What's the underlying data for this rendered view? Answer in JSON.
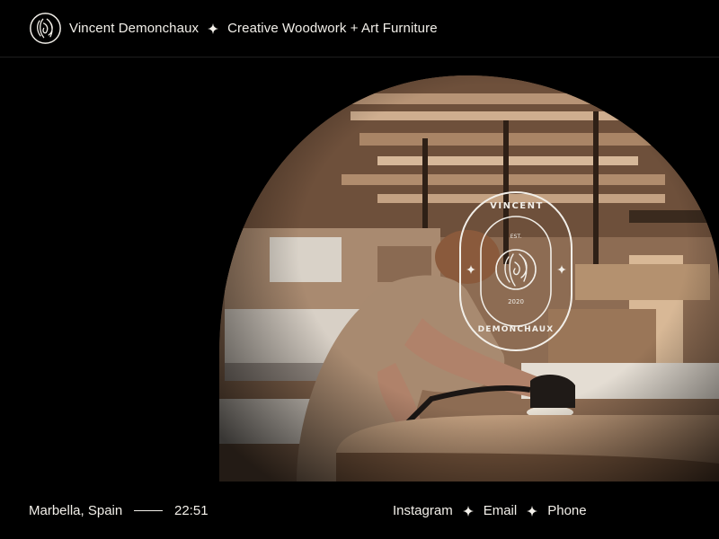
{
  "header": {
    "name": "Vincent Demonchaux",
    "tagline": "Creative Woodwork + Art Furniture",
    "logo_icon": "wood-rings-icon",
    "separator_icon": "four-point-star-icon"
  },
  "badge": {
    "top_text": "VINCENT",
    "bottom_text": "DEMONCHAUX",
    "est_label": "EST.",
    "year": "2020",
    "icon": "wood-rings-icon"
  },
  "footer": {
    "location": "Marbella, Spain",
    "time": "22:51",
    "links": [
      {
        "label": "Instagram"
      },
      {
        "label": "Email"
      },
      {
        "label": "Phone"
      }
    ]
  },
  "colors": {
    "background": "#000000",
    "text": "#f2efe9",
    "wood_light": "#c9a27e",
    "wood_dark": "#5a3f2c"
  }
}
